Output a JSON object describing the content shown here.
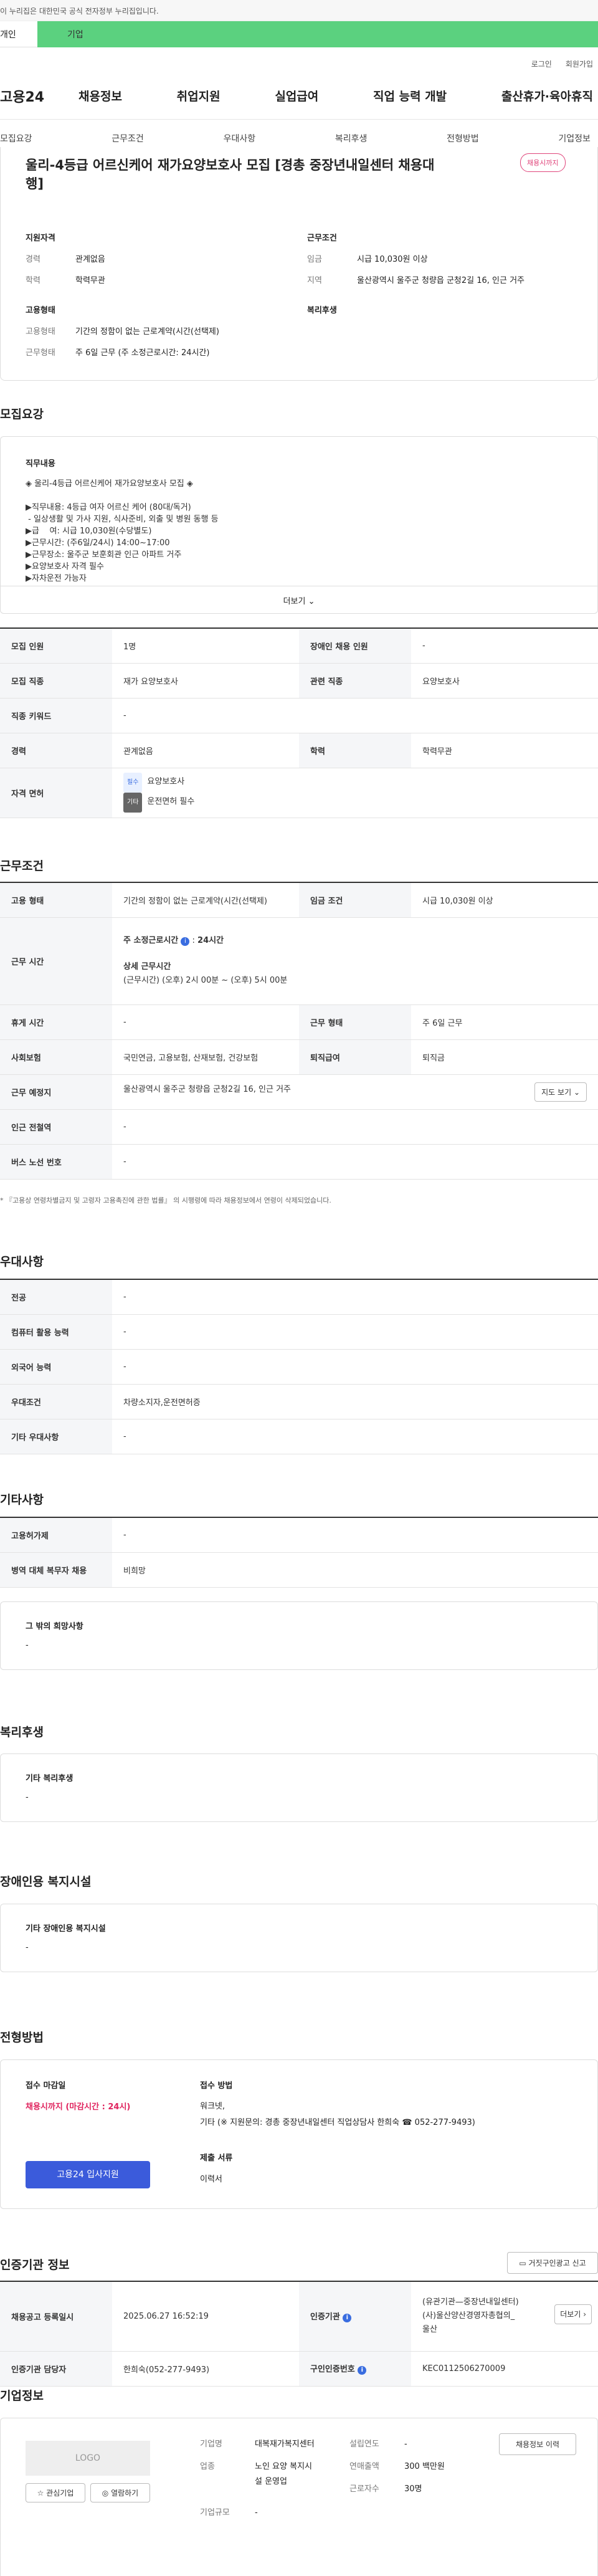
{
  "notice": "이 누리집은 대한민국 공식 전자정부 누리집입니다.",
  "toptabs": [
    "개인",
    "기업"
  ],
  "util": [
    "로그인",
    "회원가입"
  ],
  "logo": "고용24",
  "gnb": [
    "채용정보",
    "취업지원",
    "실업급여",
    "직업 능력 개발",
    "출산휴가·육아휴직"
  ],
  "subtabs": [
    "모집요강",
    "근무조건",
    "우대사항",
    "복리후생",
    "전형방법",
    "기업정보"
  ],
  "job": {
    "title_1": "울리-4등급 어르신케어 재가요양보호사 모집 [경총 중장년내일센터 채용대",
    "title_2": "행]",
    "badge": "채용시까지"
  },
  "summary": {
    "left_head1": "지원자격",
    "exp_l": "경력",
    "exp_v": "관계없음",
    "edu_l": "학력",
    "edu_v": "학력무관",
    "left_head2": "고용형태",
    "emp_l": "고용형태",
    "emp_v": "기간의 정함이 없는 근로계약(시간(선택제)",
    "work_l": "근무형태",
    "work_v": "주 6일 근무 (주 소정근로시간: 24시간)",
    "right_head1": "근무조건",
    "wage_l": "임금",
    "wage_v": "시급 10,030원 이상",
    "area_l": "지역",
    "area_v": "울산광역시 울주군 청량읍 군청2길 16, 인근 거주",
    "right_head2": "복리후생"
  },
  "recruit": {
    "section": "모집요강",
    "desc_head": "직무내용",
    "desc": [
      "◈ 울리-4등급 어르신케어 재가요양보호사 모집 ◈",
      "",
      "▶직무내용: 4등급 여자 어르신 케어 (80대/독거)",
      " - 일상생활 및 가사 지원, 식사준비, 외출 및 병원 동행 등",
      "▶급    여: 시급 10,030원(수당별도)",
      "▶근무시간: (주6일/24시) 14:00~17:00",
      "▶근무장소: 울주군 보훈회관 인근 아파트 거주",
      "▶요양보호사 자격 필수",
      "▶자차운전 가능자"
    ],
    "more": "더보기",
    "rows": [
      [
        "모집 인원",
        "1명",
        "장애인 채용 인원",
        "-"
      ],
      [
        "모집 직종",
        "재가 요양보호사",
        "관련 직종",
        "요양보호사"
      ],
      [
        "직종 키워드",
        "-"
      ],
      [
        "경력",
        "관계없음",
        "학력",
        "학력무관"
      ]
    ],
    "license_l": "자격 면허",
    "lic1_tag": "필수",
    "lic1": "요양보호사",
    "lic2_tag": "기타",
    "lic2": "운전면허 필수"
  },
  "cond": {
    "section": "근무조건",
    "emp_l": "고용 형태",
    "emp_v": "기간의 정함이 없는 근로계약(시간(선택제)",
    "wage_l": "임금 조건",
    "wage_v": "시급 10,030원 이상",
    "time_l": "근무 시간",
    "weekly_l": "주 소정근로시간",
    "weekly_v": "24시간",
    "detail_l": "상세 근무시간",
    "detail_v": "(근무시간) (오후) 2시 00분 ~ (오후) 5시 00분",
    "rest_l": "휴게 시간",
    "rest_v": "-",
    "form_l": "근무 형태",
    "form_v": "주 6일 근무",
    "ins_l": "사회보험",
    "ins_v": "국민연금, 고용보험, 산재보험, 건강보험",
    "ret_l": "퇴직급여",
    "ret_v": "퇴직금",
    "place_l": "근무 예정지",
    "place_v": "울산광역시 울주군 청량읍 군청2길 16, 인근 거주",
    "map": "지도 보기",
    "sub_l": "인근 전철역",
    "sub_v": "-",
    "bus_l": "버스 노선 번호",
    "bus_v": "-",
    "note": "* 『고용상 연령차별금지 및 고령자 고용촉진에 관한 법률』 의 시행령에 따라 채용정보에서 연령이 삭제되었습니다."
  },
  "pref": {
    "section": "우대사항",
    "rows": [
      [
        "전공",
        "-"
      ],
      [
        "컴퓨터 활용 능력",
        "-"
      ],
      [
        "외국어 능력",
        "-"
      ],
      [
        "우대조건",
        "차량소지자,운전면허증"
      ],
      [
        "기타 우대사항",
        "-"
      ]
    ]
  },
  "etc": {
    "section": "기타사항",
    "rows": [
      [
        "고용허가제",
        "-"
      ],
      [
        "병역 대체 복무자 채용",
        "비희망"
      ]
    ],
    "other_l": "그 밖의 희망사항",
    "other_v": "-"
  },
  "welfare": {
    "section": "복리후생",
    "label": "기타 복리후생",
    "value": "-"
  },
  "disab": {
    "section": "장애인용 복지시설",
    "label": "기타 장애인용 복지시설",
    "value": "-"
  },
  "screen": {
    "section": "전형방법",
    "deadline_l": "접수 마감일",
    "deadline_v": "채용시까지 (마감시간 : 24시)",
    "apply": "고용24 입사지원",
    "method_l": "접수 방법",
    "method_1": "워크넷,",
    "method_2": "기타 (※ 지원문의: 경총 중장년내일센터 직업상담사 한희숙 ☎ 052-277-9493)",
    "docs_l": "제출 서류",
    "docs_v": "이력서"
  },
  "agency": {
    "section": "인증기관 정보",
    "report": "거짓구인광고 신고",
    "reg_l": "채용공고 등록일시",
    "reg_v": "2025.06.27 16:52:19",
    "org_l": "인증기관",
    "org_v1": "(유관기관—중장년내일센터)",
    "org_v2": "(사)울산양산경영자총협의_",
    "org_v3": "울산",
    "more": "더보기",
    "mgr_l": "인증기관 담당자",
    "mgr_v": "한희숙(052-277-9493)",
    "num_l": "구인인증번호",
    "num_v": "KEC0112506270009"
  },
  "company": {
    "section": "기업정보",
    "logo": "LOGO",
    "fav": "관심기업",
    "follow": "열람하기",
    "name_l": "기업명",
    "name_v": "대복재가복지센터",
    "est_l": "설립연도",
    "est_v": "-",
    "ind_l": "업종",
    "ind_v1": "노인 요양 복지시",
    "ind_v2": "설 운영업",
    "sales_l": "연매출액",
    "sales_v": "300 백만원",
    "emp_l": "근로자수",
    "emp_v": "30명",
    "scale_l": "기업규모",
    "scale_v": "-",
    "history": "채용정보 이력"
  }
}
